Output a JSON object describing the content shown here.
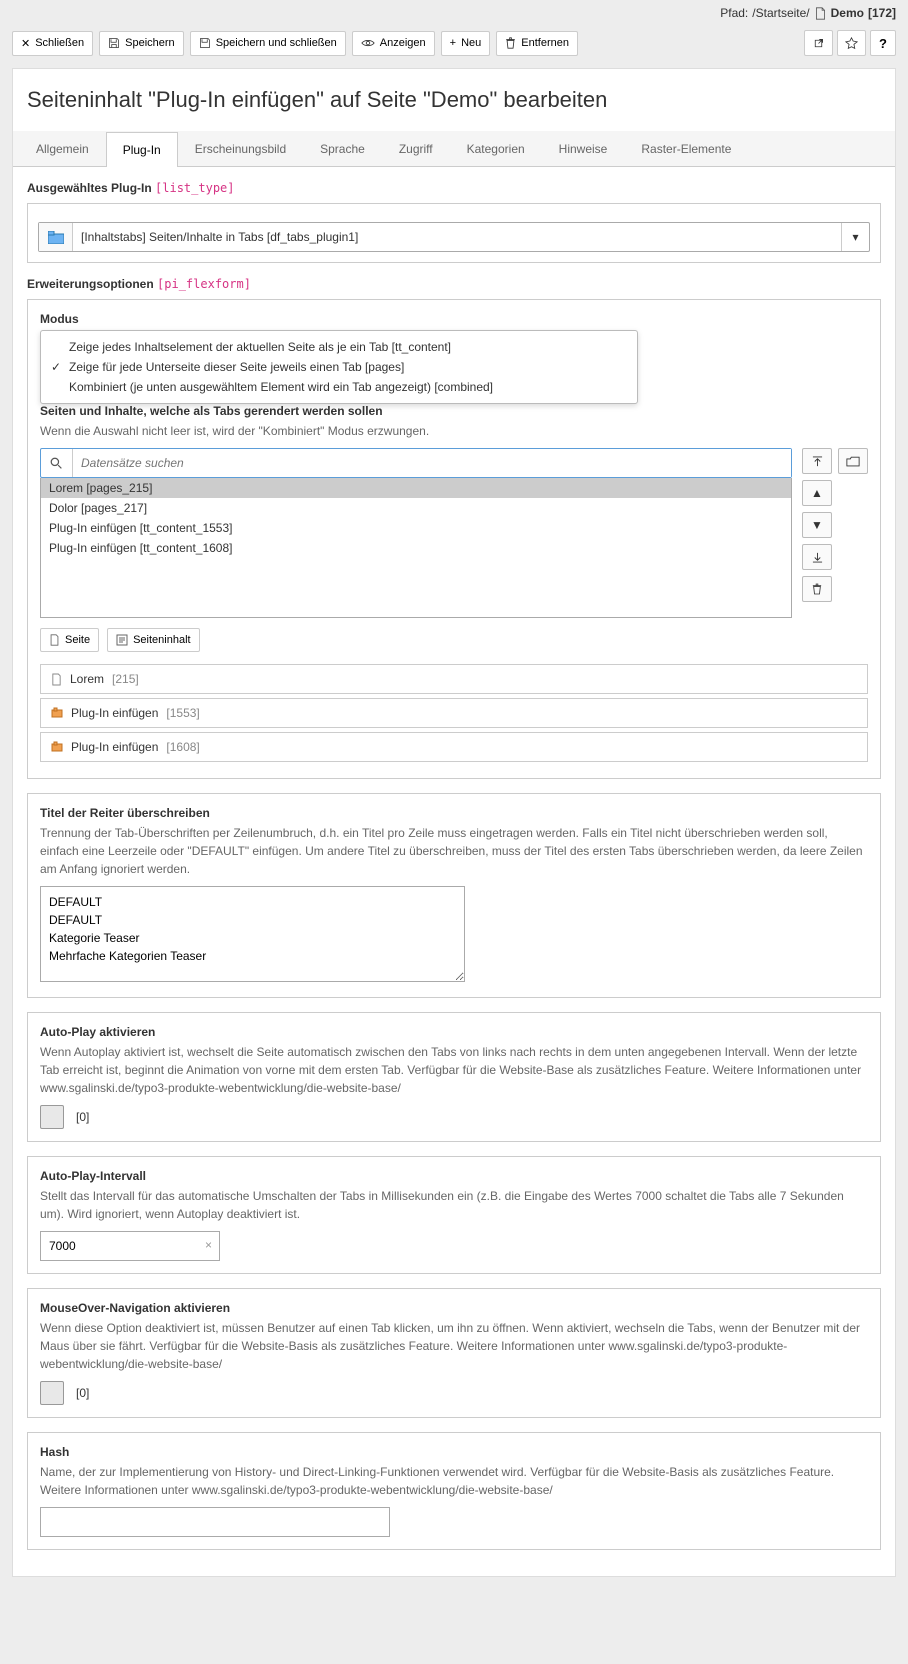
{
  "path": {
    "prefix": "Pfad:",
    "crumb": "/Startseite/",
    "page_name": "Demo",
    "page_id": "[172]"
  },
  "toolbar": {
    "close": "Schließen",
    "save": "Speichern",
    "save_close": "Speichern und schließen",
    "view": "Anzeigen",
    "new": "Neu",
    "delete": "Entfernen"
  },
  "page_title": "Seiteninhalt \"Plug-In einfügen\" auf Seite \"Demo\" bearbeiten",
  "tabs": [
    "Allgemein",
    "Plug-In",
    "Erscheinungsbild",
    "Sprache",
    "Zugriff",
    "Kategorien",
    "Hinweise",
    "Raster-Elemente"
  ],
  "plugin_label": "Ausgewähltes Plug-In",
  "plugin_tech": "[list_type]",
  "plugin_value": "[Inhaltstabs] Seiten/Inhalte in Tabs [df_tabs_plugin1]",
  "ext_label": "Erweiterungsoptionen",
  "ext_tech": "[pi_flexform]",
  "mode_label": "Modus",
  "mode_options": [
    "Zeige jedes Inhaltselement der aktuellen Seite als je ein Tab [tt_content]",
    "Zeige für jede Unterseite dieser Seite jeweils einen Tab [pages]",
    "Kombiniert (je unten ausgewähltem Element wird ein Tab angezeigt) [combined]"
  ],
  "records_label": "Seiten und Inhalte, welche als Tabs gerendert werden sollen",
  "records_help": "Wenn die Auswahl nicht leer ist, wird der \"Kombiniert\" Modus erzwungen.",
  "search_placeholder": "Datensätze suchen",
  "list_items": [
    "Lorem [pages_215]",
    "Dolor [pages_217]",
    "Plug-In einfügen [tt_content_1553]",
    "Plug-In einfügen [tt_content_1608]"
  ],
  "btn_page": "Seite",
  "btn_content": "Seiteninhalt",
  "refs": [
    {
      "name": "Lorem",
      "id": "[215]",
      "kind": "page"
    },
    {
      "name": "Plug-In einfügen",
      "id": "[1553]",
      "kind": "content"
    },
    {
      "name": "Plug-In einfügen",
      "id": "[1608]",
      "kind": "content"
    }
  ],
  "titles_label": "Titel der Reiter überschreiben",
  "titles_help": "Trennung der Tab-Überschriften per Zeilenumbruch, d.h. ein Titel pro Zeile muss eingetragen werden. Falls ein Titel nicht überschrieben werden soll, einfach eine Leerzeile oder \"DEFAULT\" einfügen. Um andere Titel zu überschreiben, muss der Titel des ersten Tabs überschrieben werden, da leere Zeilen am Anfang ignoriert werden.",
  "titles_value": "DEFAULT\nDEFAULT\nKategorie Teaser\nMehrfache Kategorien Teaser",
  "autoplay_label": "Auto-Play aktivieren",
  "autoplay_help": "Wenn Autoplay aktiviert ist, wechselt die Seite automatisch zwischen den Tabs von links nach rechts in dem unten angegebenen Intervall. Wenn der letzte Tab erreicht ist, beginnt die Animation von vorne mit dem ersten Tab. Verfügbar für die Website-Base als zusätzliches Feature. Weitere Informationen unter www.sgalinski.de/typo3-produkte-webentwicklung/die-website-base/",
  "checkbox_off": "[0]",
  "interval_label": "Auto-Play-Intervall",
  "interval_help": "Stellt das Intervall für das automatische Umschalten der Tabs in Millisekunden ein (z.B. die Eingabe des Wertes 7000 schaltet die Tabs alle 7 Sekunden um). Wird ignoriert, wenn Autoplay deaktiviert ist.",
  "interval_value": "7000",
  "mouseover_label": "MouseOver-Navigation aktivieren",
  "mouseover_help": "Wenn diese Option deaktiviert ist, müssen Benutzer auf einen Tab klicken, um ihn zu öffnen. Wenn aktiviert, wechseln die Tabs, wenn der Benutzer mit der Maus über sie fährt. Verfügbar für die Website-Basis als zusätzliches Feature. Weitere Informationen unter www.sgalinski.de/typo3-produkte-webentwicklung/die-website-base/",
  "hash_label": "Hash",
  "hash_help": "Name, der zur Implementierung von History- und Direct-Linking-Funktionen verwendet wird. Verfügbar für die Website-Basis als zusätzliches Feature. Weitere Informationen unter www.sgalinski.de/typo3-produkte-webentwicklung/die-website-base/"
}
